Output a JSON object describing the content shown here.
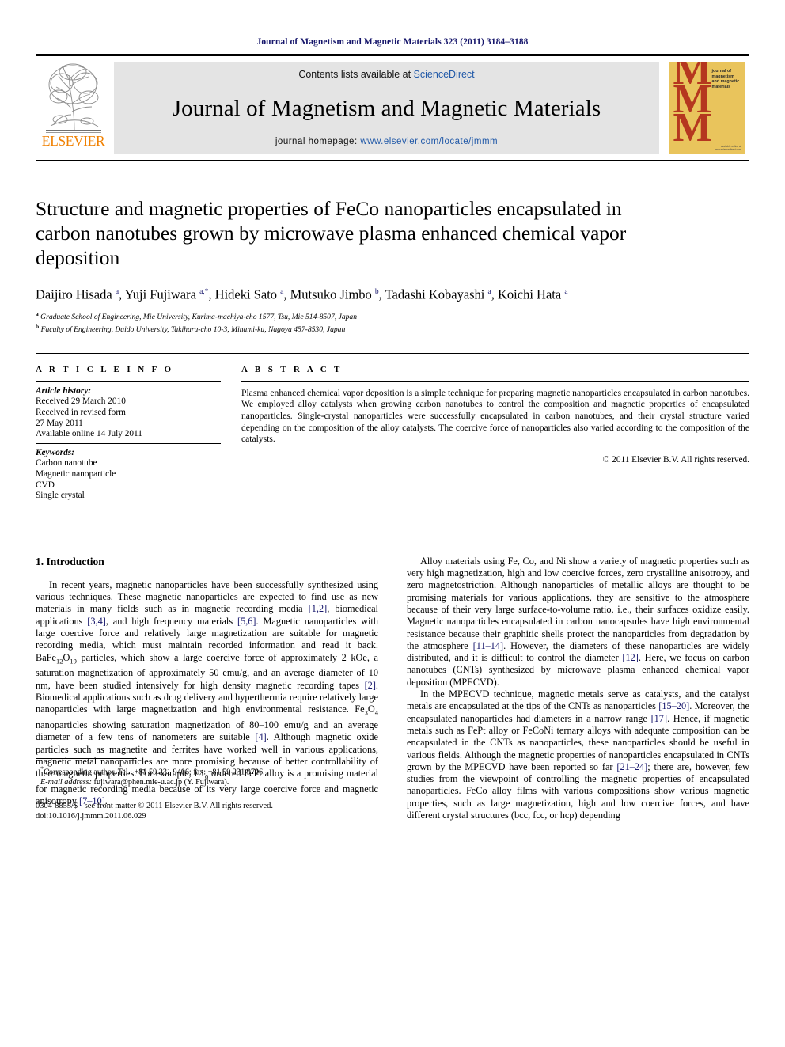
{
  "running_head": "Journal of Magnetism and Magnetic Materials 323 (2011) 3184–3188",
  "masthead": {
    "publisher_name": "ELSEVIER",
    "contents_prefix": "Contents lists available at ",
    "contents_link": "ScienceDirect",
    "journal_title": "Journal of Magnetism and Magnetic Materials",
    "homepage_prefix": "journal homepage: ",
    "homepage_url": "www.elsevier.com/locate/jmmm",
    "cover": {
      "letters": "MMM",
      "title_text": "journal of magnetism and magnetic materials",
      "foot_text": "available online at www.sciencedirect.com"
    }
  },
  "article": {
    "title": "Structure and magnetic properties of FeCo nanoparticles encapsulated in carbon nanotubes grown by microwave plasma enhanced chemical vapor deposition",
    "authors_html": "Daijiro Hisada <sup>a</sup>, Yuji Fujiwara <sup>a,</sup><sup>*</sup>, Hideki Sato <sup>a</sup>, Mutsuko Jimbo <sup>b</sup>, Tadashi Kobayashi <sup>a</sup>, Koichi Hata <sup>a</sup>",
    "affiliations": [
      {
        "marker": "a",
        "text": "Graduate School of Engineering, Mie University, Kurima-machiya-cho 1577, Tsu, Mie 514-8507, Japan"
      },
      {
        "marker": "b",
        "text": "Faculty of Engineering, Daido University, Takiharu-cho 10-3, Minami-ku, Nagoya 457-8530, Japan"
      }
    ]
  },
  "article_info": {
    "heading": "A R T I C L E   I N F O",
    "history_label": "Article history:",
    "history": [
      "Received 29 March 2010",
      "Received in revised form",
      "27 May 2011",
      "Available online 14 July 2011"
    ],
    "keywords_label": "Keywords:",
    "keywords": [
      "Carbon nanotube",
      "Magnetic nanoparticle",
      "CVD",
      "Single crystal"
    ]
  },
  "abstract": {
    "heading": "A B S T R A C T",
    "text": "Plasma enhanced chemical vapor deposition is a simple technique for preparing magnetic nanoparticles encapsulated in carbon nanotubes. We employed alloy catalysts when growing carbon nanotubes to control the composition and magnetic properties of encapsulated nanoparticles. Single-crystal nanoparticles were successfully encapsulated in carbon nanotubes, and their crystal structure varied depending on the composition of the alloy catalysts. The coercive force of nanoparticles also varied according to the composition of the catalysts.",
    "copyright": "© 2011 Elsevier B.V. All rights reserved."
  },
  "body": {
    "section_heading": "1.  Introduction",
    "left_paragraphs_html": [
      "In recent years, magnetic nanoparticles have been successfully synthesized using various techniques. These magnetic nanoparticles are expected to find use as new materials in many fields such as in magnetic recording media <span class=\"ref\">[1,2]</span>, biomedical applications <span class=\"ref\">[3,4]</span>, and high frequency materials <span class=\"ref\">[5,6]</span>. Magnetic nanoparticles with large coercive force and relatively large magnetization are suitable for magnetic recording media, which must maintain recorded information and read it back. BaFe<sub>12</sub>O<sub>19</sub> particles, which show a large coercive force of approximately 2 kOe, a saturation magnetization of approximately 50 emu/g, and an average diameter of 10 nm, have been studied intensively for high density magnetic recording tapes <span class=\"ref\">[2]</span>. Biomedical applications such as drug delivery and hyperthermia require relatively large nanoparticles with large magnetization and high environmental resistance. Fe<sub>3</sub>O<sub>4</sub> nanoparticles showing saturation magnetization of 80–100 emu/g and an average diameter of a few tens of nanometers are suitable <span class=\"ref\">[4]</span>. Although magnetic oxide particles such as magnetite and ferrites have worked well in various applications, magnetic metal nanoparticles are more promising because of better controllability of their magnetic properties. For example, L1<sub>0</sub> ordered FePt alloy is a promising material for magnetic recording media because of its very large coercive force and magnetic anisotropy <span class=\"ref\">[7–10]</span>."
    ],
    "right_paragraphs_html": [
      "Alloy materials using Fe, Co, and Ni show a variety of magnetic properties such as very high magnetization, high and low coercive forces, zero crystalline anisotropy, and zero magnetostriction. Although nanoparticles of metallic alloys are thought to be promising materials for various applications, they are sensitive to the atmosphere because of their very large surface-to-volume ratio, i.e., their surfaces oxidize easily. Magnetic nanoparticles encapsulated in carbon nanocapsules have high environmental resistance because their graphitic shells protect the nanoparticles from degradation by the atmosphere <span class=\"ref\">[11–14]</span>. However, the diameters of these nanoparticles are widely distributed, and it is difficult to control the diameter <span class=\"ref\">[12]</span>. Here, we focus on carbon nanotubes (CNTs) synthesized by microwave plasma enhanced chemical vapor deposition (MPECVD).",
      "In the MPECVD technique, magnetic metals serve as catalysts, and the catalyst metals are encapsulated at the tips of the CNTs as nanoparticles <span class=\"ref\">[15–20]</span>. Moreover, the encapsulated nanoparticles had diameters in a narrow range <span class=\"ref\">[17]</span>. Hence, if magnetic metals such as FePt alloy or FeCoNi ternary alloys with adequate composition can be encapsulated in the CNTs as nanoparticles, these nanoparticles should be useful in various fields. Although the magnetic properties of nanoparticles encapsulated in CNTs grown by the MPECVD have been reported so far <span class=\"ref\">[21–24]</span>; there are, however, few studies from the viewpoint of controlling the magnetic properties of encapsulated nanoparticles. FeCo alloy films with various compositions show various magnetic properties, such as large magnetization, high and low coercive forces, and have different crystal structures (bcc, fcc, or hcp) depending"
    ]
  },
  "footnotes": {
    "corresponding_html": "<sup>*</sup>Corresponding author. Tel.: +81 59 231 9406; fax: +81 59 231 9726.",
    "email_html": "<span class=\"em\">E-mail address:</span> fujiwara@phen.mie-u.ac.jp (Y. Fujiwara).",
    "issn_line": "0304-8853/$ - see front matter © 2011 Elsevier B.V. All rights reserved.",
    "doi_line": "doi:10.1016/j.jmmm.2011.06.029"
  },
  "colors": {
    "link_blue": "#2159a8",
    "ref_blue": "#16166b",
    "elsevier_orange": "#f08000",
    "cover_gold": "#e9c45c",
    "cover_red": "#b5371f",
    "banner_gray": "#e4e4e4"
  }
}
